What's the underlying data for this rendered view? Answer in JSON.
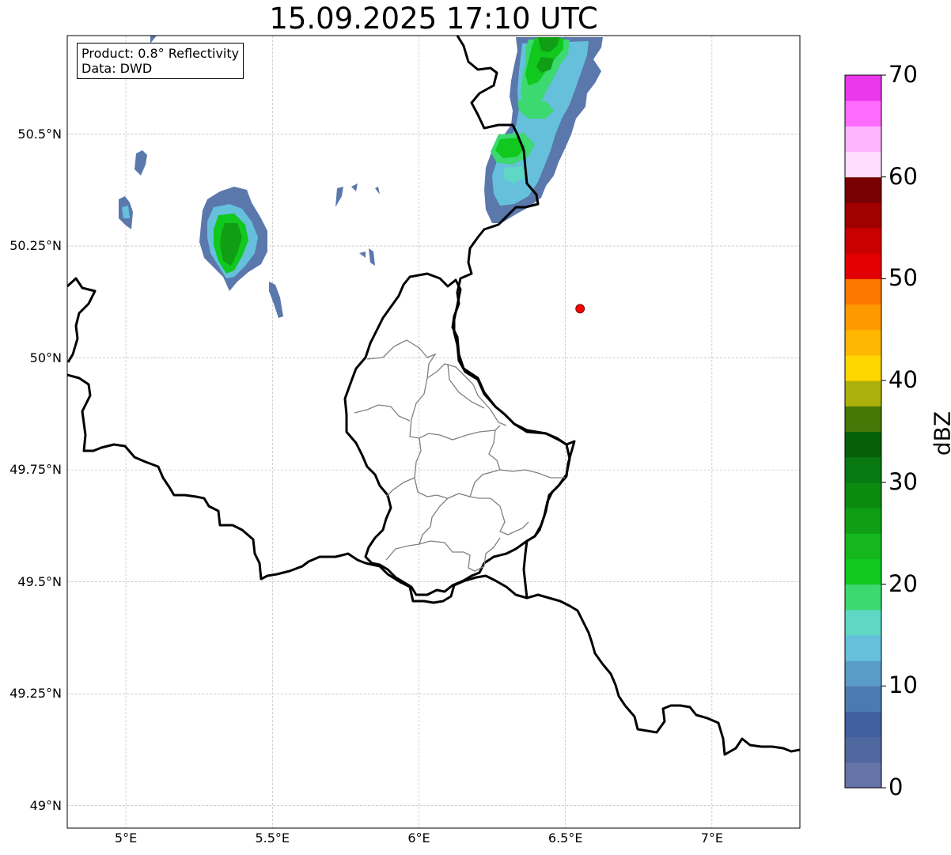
{
  "title": "15.09.2025 17:10 UTC",
  "info": {
    "product_line": "Product: 0.8° Reflectivity",
    "data_line": "Data: DWD"
  },
  "map": {
    "extent": {
      "lon": [
        4.8,
        7.3
      ],
      "lat": [
        48.95,
        50.72
      ]
    },
    "y_ticks": [
      {
        "value": 50.5,
        "label": "50.5°N"
      },
      {
        "value": 50.25,
        "label": "50.25°N"
      },
      {
        "value": 50.0,
        "label": "50°N"
      },
      {
        "value": 49.75,
        "label": "49.75°N"
      },
      {
        "value": 49.5,
        "label": "49.5°N"
      },
      {
        "value": 49.25,
        "label": "49.25°N"
      },
      {
        "value": 49.0,
        "label": "49°N"
      }
    ],
    "x_ticks": [
      {
        "value": 5.0,
        "label": "5°E"
      },
      {
        "value": 5.5,
        "label": "5.5°E"
      },
      {
        "value": 6.0,
        "label": "6°E"
      },
      {
        "value": 6.5,
        "label": "6.5°E"
      },
      {
        "value": 7.0,
        "label": "7°E"
      }
    ],
    "marker": {
      "lon": 6.55,
      "lat": 50.11,
      "color": "#ff0000"
    },
    "grid": true
  },
  "colorbar": {
    "label": "dBZ",
    "min": 0,
    "max": 70,
    "ticks": [
      "0",
      "10",
      "20",
      "30",
      "40",
      "50",
      "60",
      "70"
    ],
    "colors": [
      "#6474a8",
      "#5068a0",
      "#4060a0",
      "#4c7ab0",
      "#5a9cc8",
      "#66c0dc",
      "#5ed8c4",
      "#3cd870",
      "#10c81e",
      "#14b81e",
      "#109e14",
      "#0c8a10",
      "#087810",
      "#066008",
      "#467808",
      "#acb00a",
      "#fed600",
      "#feb600",
      "#fe9a00",
      "#fe7800",
      "#e20000",
      "#c80000",
      "#a00000",
      "#780000",
      "#fedcfe",
      "#feb4fe",
      "#fe6cfe",
      "#ec38ec"
    ]
  }
}
